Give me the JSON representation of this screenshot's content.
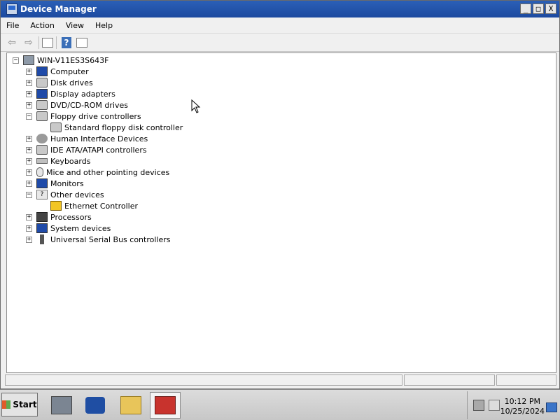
{
  "window": {
    "title": "Device Manager",
    "controls": {
      "minimize": "_",
      "maximize": "□",
      "close": "X"
    }
  },
  "menu": [
    "File",
    "Action",
    "View",
    "Help"
  ],
  "toolbar": {
    "back": "⇦",
    "forward": "⇨",
    "help": "?"
  },
  "tree": {
    "root": "WIN-V11ES3S643F",
    "items": [
      {
        "label": "Computer",
        "expanded": false,
        "icon": "computer-icon"
      },
      {
        "label": "Disk drives",
        "expanded": false,
        "icon": "disk-drive-icon"
      },
      {
        "label": "Display adapters",
        "expanded": false,
        "icon": "display-adapter-icon"
      },
      {
        "label": "DVD/CD-ROM drives",
        "expanded": false,
        "icon": "dvd-drive-icon"
      },
      {
        "label": "Floppy drive controllers",
        "expanded": true,
        "icon": "floppy-controller-icon",
        "children": [
          "Standard floppy disk controller"
        ]
      },
      {
        "label": "Human Interface Devices",
        "expanded": false,
        "icon": "hid-icon"
      },
      {
        "label": "IDE ATA/ATAPI controllers",
        "expanded": false,
        "icon": "ide-controller-icon"
      },
      {
        "label": "Keyboards",
        "expanded": false,
        "icon": "keyboard-icon"
      },
      {
        "label": "Mice and other pointing devices",
        "expanded": false,
        "icon": "mouse-icon"
      },
      {
        "label": "Monitors",
        "expanded": false,
        "icon": "monitor-icon"
      },
      {
        "label": "Other devices",
        "expanded": true,
        "icon": "other-devices-icon",
        "children": [
          "Ethernet Controller"
        ]
      },
      {
        "label": "Processors",
        "expanded": false,
        "icon": "processor-icon"
      },
      {
        "label": "System devices",
        "expanded": false,
        "icon": "system-devices-icon"
      },
      {
        "label": "Universal Serial Bus controllers",
        "expanded": false,
        "icon": "usb-icon"
      }
    ]
  },
  "taskbar": {
    "start_label": "Start",
    "time": "10:12 PM",
    "date": "10/25/2024"
  }
}
